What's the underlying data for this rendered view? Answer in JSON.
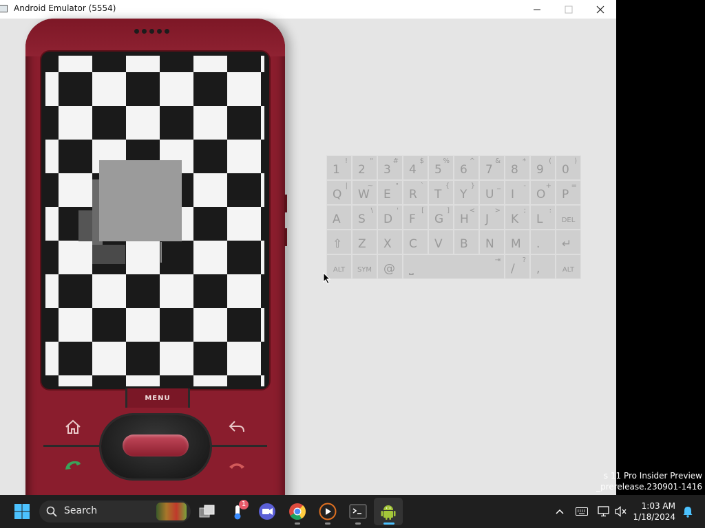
{
  "window": {
    "title": "Android Emulator (5554)",
    "controls": [
      "minimize-icon",
      "maximize-icon",
      "close-icon"
    ]
  },
  "phone": {
    "menu_label": "MENU",
    "buttons": [
      "home-icon",
      "back-icon",
      "call-icon",
      "end-call-icon"
    ],
    "screen": {
      "pattern": "checkerboard",
      "colors": {
        "dark": "#1a1a1a",
        "light": "#f4f4f4",
        "overlay": "#9b9b9b"
      }
    }
  },
  "keyboard": {
    "rows": [
      [
        {
          "p": "1",
          "s": "!"
        },
        {
          "p": "2",
          "s": "\""
        },
        {
          "p": "3",
          "s": "#"
        },
        {
          "p": "4",
          "s": "$"
        },
        {
          "p": "5",
          "s": "%"
        },
        {
          "p": "6",
          "s": "^"
        },
        {
          "p": "7",
          "s": "&"
        },
        {
          "p": "8",
          "s": "*"
        },
        {
          "p": "9",
          "s": "("
        },
        {
          "p": "0",
          "s": ")"
        }
      ],
      [
        {
          "p": "Q",
          "s": "|"
        },
        {
          "p": "W",
          "s": "~"
        },
        {
          "p": "E",
          "s": "\""
        },
        {
          "p": "R",
          "s": "`"
        },
        {
          "p": "T",
          "s": "{"
        },
        {
          "p": "Y",
          "s": "}"
        },
        {
          "p": "U",
          "s": "_"
        },
        {
          "p": "I",
          "s": "-"
        },
        {
          "p": "O",
          "s": "+"
        },
        {
          "p": "P",
          "s": "="
        }
      ],
      [
        {
          "p": "A",
          "s": ""
        },
        {
          "p": "S",
          "s": "\\"
        },
        {
          "p": "D",
          "s": "'"
        },
        {
          "p": "F",
          "s": "["
        },
        {
          "p": "G",
          "s": "]"
        },
        {
          "p": "H",
          "s": "<"
        },
        {
          "p": "J",
          "s": ">"
        },
        {
          "p": "K",
          "s": ";"
        },
        {
          "p": "L",
          "s": ":"
        },
        {
          "p": "DEL",
          "s": ""
        }
      ],
      [
        {
          "p": "⇧",
          "s": ""
        },
        {
          "p": "Z",
          "s": ""
        },
        {
          "p": "X",
          "s": ""
        },
        {
          "p": "C",
          "s": ""
        },
        {
          "p": "V",
          "s": ""
        },
        {
          "p": "B",
          "s": ""
        },
        {
          "p": "N",
          "s": ""
        },
        {
          "p": "M",
          "s": ""
        },
        {
          "p": ".",
          "s": ""
        },
        {
          "p": "↵",
          "s": ""
        }
      ]
    ],
    "bottom_row": {
      "alt_left": "ALT",
      "sym": "SYM",
      "at": "@",
      "space": "⎵",
      "tab": "⇥",
      "slash": "/",
      "slash_alt": "?",
      "comma": ",",
      "alt_right": "ALT"
    }
  },
  "watermark": {
    "line1": "s 11 Pro Insider Preview",
    "line2": "_prerelease.230901-1416"
  },
  "taskbar": {
    "search_label": "Search",
    "weather_badge": "1",
    "apps": [
      "start-icon",
      "task-view-icon",
      "weather-icon",
      "video-call-icon",
      "chrome-icon",
      "media-player-icon",
      "terminal-icon",
      "android-icon"
    ],
    "tray": [
      "chevron-up-icon",
      "keyboard-icon",
      "display-icon",
      "volume-muted-icon",
      "notification-bell-icon"
    ],
    "time": "1:03 AM",
    "date": "1/18/2024"
  }
}
